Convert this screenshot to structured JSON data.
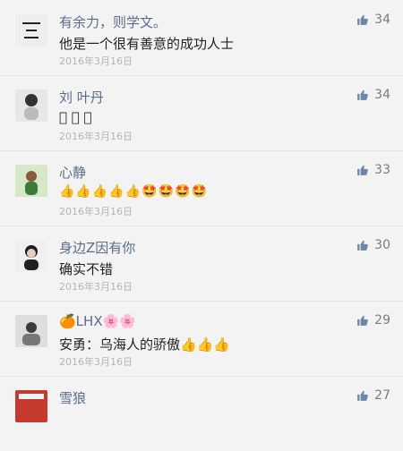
{
  "comments": [
    {
      "name": "有余力，则学文。",
      "text": "他是一个很有善意的成功人士",
      "date": "2016年3月16日",
      "likes": "34",
      "avatar": "calligraphy"
    },
    {
      "name": "刘 叶丹",
      "text": "\u0000 \u0000 \u0000",
      "date": "2016年3月16日",
      "likes": "34",
      "avatar": "person"
    },
    {
      "name": "心静",
      "text": "👍👍👍👍👍🤩🤩🤩🤩",
      "date": "2016年3月16日",
      "likes": "33",
      "avatar": "child"
    },
    {
      "name": "身边Z因有你",
      "text": "确实不错",
      "date": "2016年3月16日",
      "likes": "30",
      "avatar": "woman"
    },
    {
      "name": "🍊LHX🌸🌸",
      "text": "安勇：乌海人的骄傲👍👍👍",
      "date": "2016年3月16日",
      "likes": "29",
      "avatar": "group"
    },
    {
      "name": "雪狼",
      "text": "",
      "date": "",
      "likes": "27",
      "avatar": "red"
    }
  ],
  "icons": {
    "like": "thumbs-up-icon"
  },
  "colors": {
    "name": "#5b6c8a",
    "like": "#6d86a6"
  }
}
